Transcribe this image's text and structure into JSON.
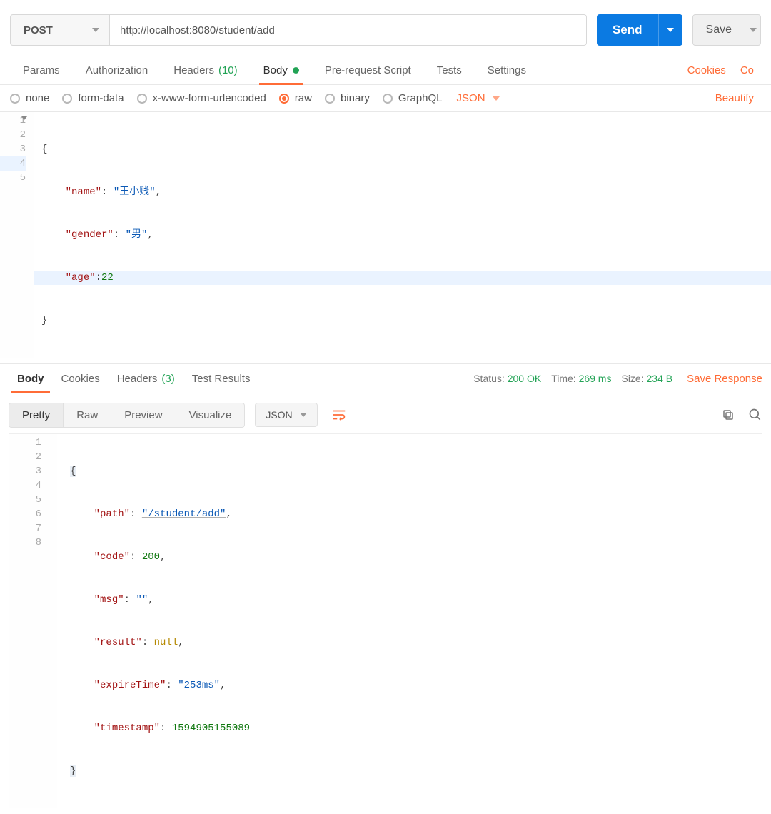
{
  "request": {
    "method": "POST",
    "url": "http://localhost:8080/student/add",
    "sendLabel": "Send",
    "saveLabel": "Save"
  },
  "requestTabs": {
    "params": "Params",
    "authorization": "Authorization",
    "headers": "Headers",
    "headersCount": "(10)",
    "body": "Body",
    "preRequest": "Pre-request Script",
    "tests": "Tests",
    "settings": "Settings",
    "cookies": "Cookies",
    "code": "Co"
  },
  "bodyOptions": {
    "none": "none",
    "formData": "form-data",
    "xwww": "x-www-form-urlencoded",
    "raw": "raw",
    "binary": "binary",
    "graphql": "GraphQL",
    "rawType": "JSON",
    "beautify": "Beautify"
  },
  "requestBody": {
    "lines": [
      "1",
      "2",
      "3",
      "4",
      "5"
    ],
    "l1": "{",
    "k_name": "\"name\"",
    "v_name": "\"王小贱\"",
    "k_gender": "\"gender\"",
    "v_gender": "\"男\"",
    "k_age": "\"age\"",
    "v_age": "22",
    "l5": "}"
  },
  "responseHeader": {
    "tabs": {
      "body": "Body",
      "cookies": "Cookies",
      "headers": "Headers",
      "headersCount": "(3)",
      "testResults": "Test Results"
    },
    "statusLabel": "Status:",
    "statusValue": "200 OK",
    "timeLabel": "Time:",
    "timeValue": "269 ms",
    "sizeLabel": "Size:",
    "sizeValue": "234 B",
    "saveResponse": "Save Response"
  },
  "responseToolbar": {
    "pretty": "Pretty",
    "raw": "Raw",
    "preview": "Preview",
    "visualize": "Visualize",
    "type": "JSON"
  },
  "responseBody": {
    "lines": [
      "1",
      "2",
      "3",
      "4",
      "5",
      "6",
      "7",
      "8"
    ],
    "l1": "{",
    "k_path": "\"path\"",
    "v_path": "\"/student/add\"",
    "k_code": "\"code\"",
    "v_code": "200",
    "k_msg": "\"msg\"",
    "v_msg": "\"\"",
    "k_result": "\"result\"",
    "v_result": "null",
    "k_expire": "\"expireTime\"",
    "v_expire": "\"253ms\"",
    "k_ts": "\"timestamp\"",
    "v_ts": "1594905155089",
    "l8": "}"
  }
}
